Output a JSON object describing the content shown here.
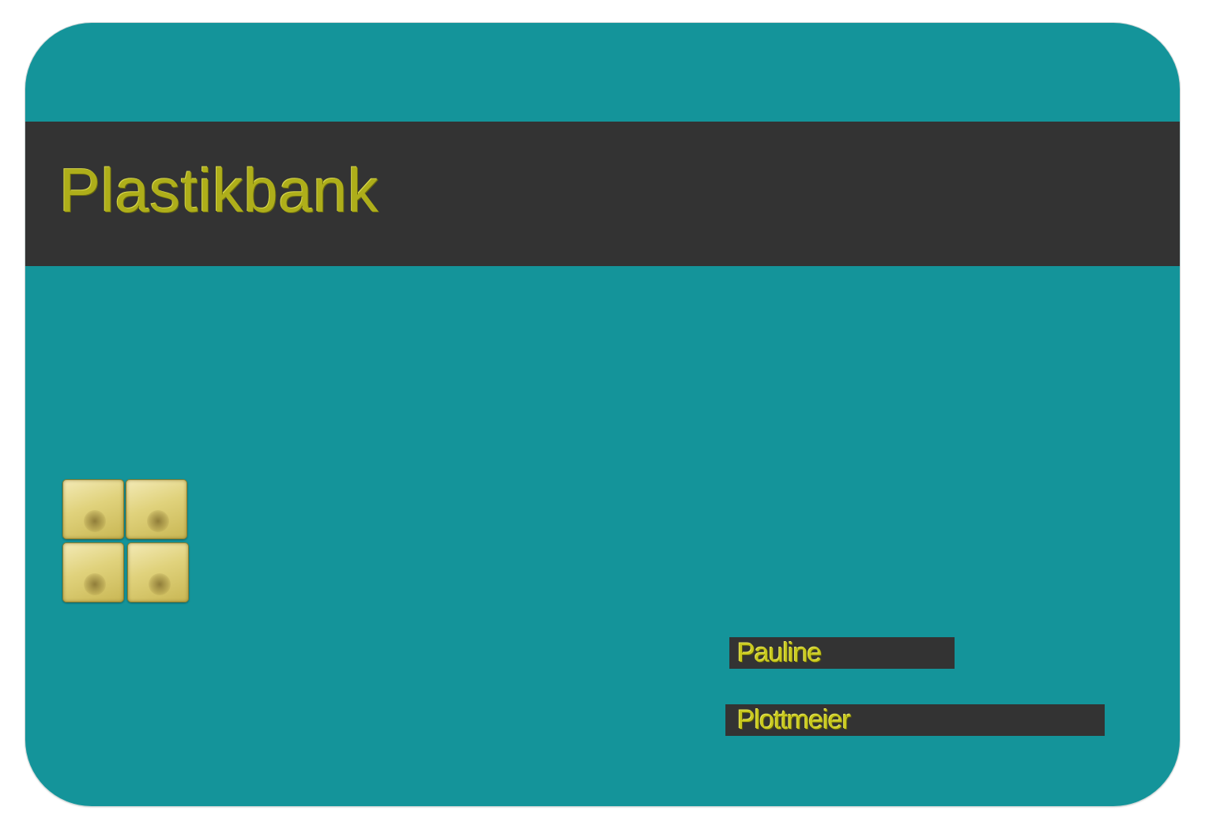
{
  "card": {
    "bank_name": "Plastikbank",
    "cardholder": {
      "first_name": "Pauline",
      "last_name": "Plottmeier"
    },
    "colors": {
      "card_background": "#14949a",
      "stripe": "#333333",
      "text": "#aeae1a",
      "chip": "#e0d27c"
    },
    "chip_icon": "smart-card-chip-icon"
  }
}
